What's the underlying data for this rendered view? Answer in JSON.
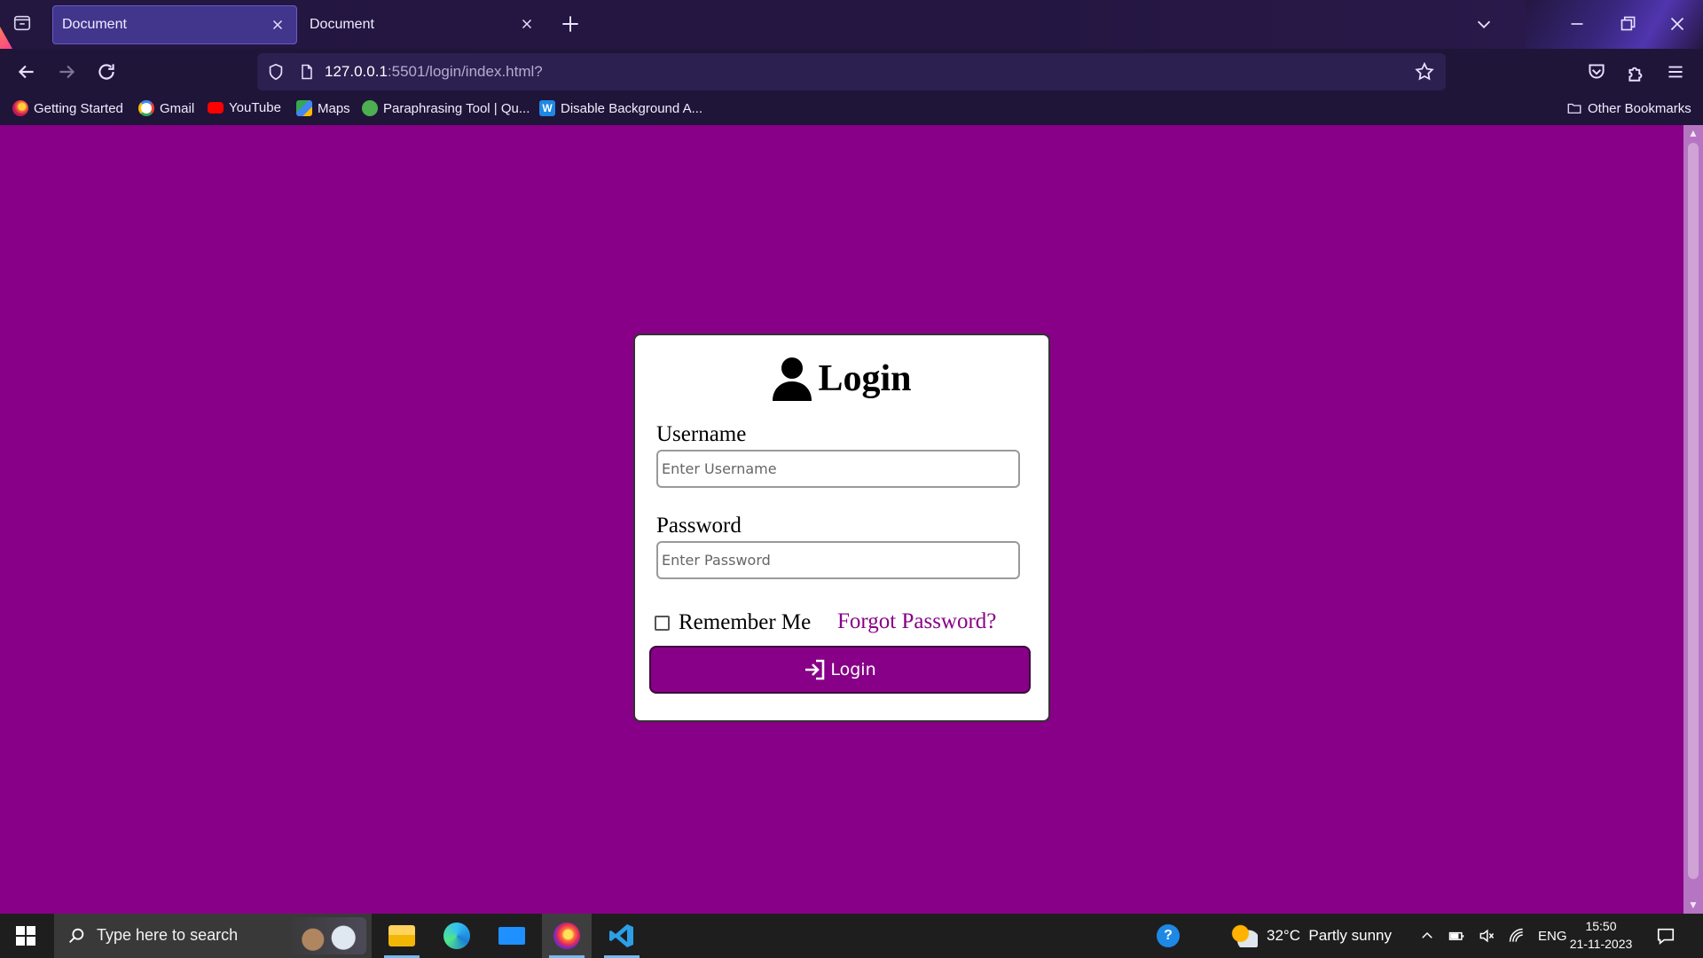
{
  "browser": {
    "tabs": [
      {
        "title": "Document",
        "active": true
      },
      {
        "title": "Document",
        "active": false
      }
    ],
    "url_host": "127.0.0.1",
    "url_rest": ":5501/login/index.html?",
    "bookmarks": [
      {
        "label": "Getting Started",
        "icon": "firefox-icon",
        "color": "#ff7139"
      },
      {
        "label": "Gmail",
        "icon": "google-icon",
        "color": "#4285f4"
      },
      {
        "label": "YouTube",
        "icon": "youtube-icon",
        "color": "#ff0000"
      },
      {
        "label": "Maps",
        "icon": "maps-icon",
        "color": "#34a853"
      },
      {
        "label": "Paraphrasing Tool | Qu...",
        "icon": "quillbot-icon",
        "color": "#4caf50"
      },
      {
        "label": "Disable Background A...",
        "icon": "w-icon",
        "color": "#1e88e5"
      }
    ],
    "other_bookmarks": "Other Bookmarks"
  },
  "login": {
    "title": "Login",
    "username_label": "Username",
    "username_placeholder": "Enter Username",
    "password_label": "Password",
    "password_placeholder": "Enter Password",
    "remember_label": "Remember Me",
    "remember_checked": false,
    "forgot_label": "Forgot Password?",
    "button_label": "Login",
    "accent_color": "#870087"
  },
  "taskbar": {
    "search_placeholder": "Type here to search",
    "weather": "32°C  Partly sunny",
    "language": "ENG",
    "time": "15:50",
    "date": "21-11-2023"
  }
}
